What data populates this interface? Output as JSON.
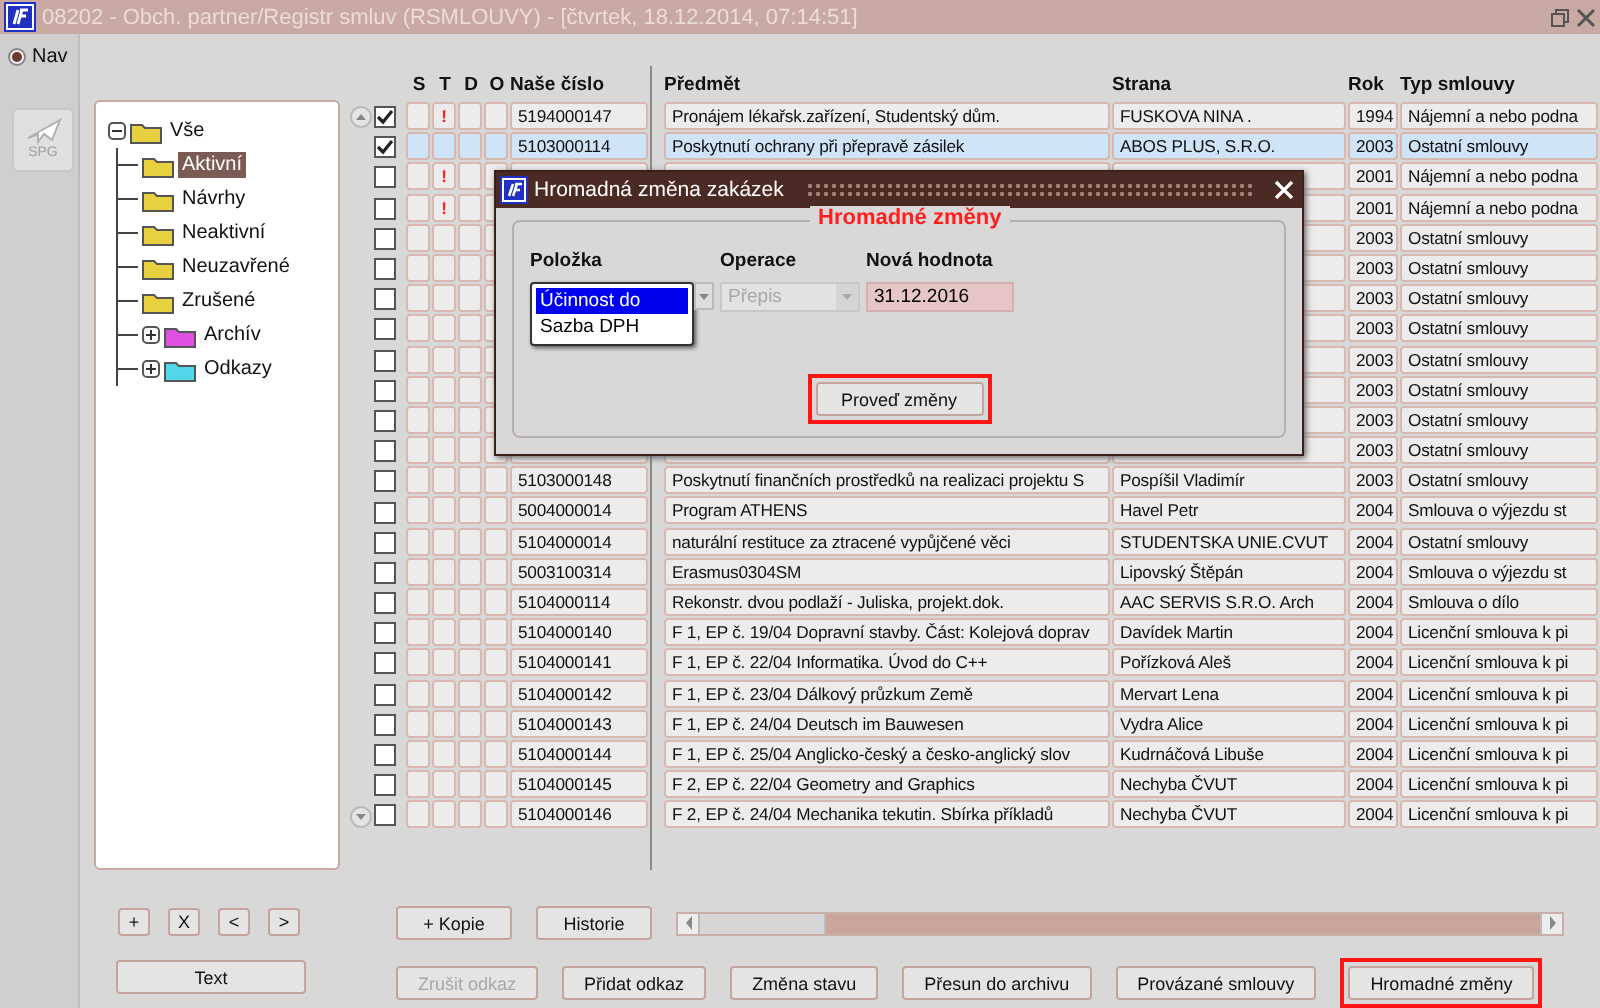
{
  "window": {
    "title": "08202 - Obch. partner/Registr smluv (RSMLOUVY) - [čtvrtek, 18.12.2014, 07:14:51]"
  },
  "nav": {
    "label": "Nav",
    "selected": true,
    "tool_label": "SPG"
  },
  "tree": [
    {
      "label": "Vše",
      "expanded": true,
      "selected": false,
      "color": "#e8d040",
      "children": [
        {
          "label": "Aktivní",
          "selected": true,
          "color": "#e8d040"
        },
        {
          "label": "Návrhy",
          "selected": false,
          "color": "#e8d040"
        },
        {
          "label": "Neaktivní",
          "selected": false,
          "color": "#e8d040"
        },
        {
          "label": "Neuzavřené",
          "selected": false,
          "color": "#e8d040"
        },
        {
          "label": "Zrušené",
          "selected": false,
          "color": "#e8d040"
        },
        {
          "label": "Archív",
          "expanded": false,
          "selected": false,
          "color": "#e050e0"
        },
        {
          "label": "Odkazy",
          "expanded": false,
          "selected": false,
          "color": "#50d8e8"
        }
      ]
    }
  ],
  "tree_buttons": [
    "+",
    "X",
    "<",
    ">"
  ],
  "text_button": "Text",
  "table": {
    "columns": [
      "S",
      "T",
      "D",
      "O",
      "Naše číslo",
      "Předmět",
      "Strana",
      "Rok",
      "Typ smlouvy"
    ],
    "rows": [
      {
        "checked": true,
        "selected": false,
        "t": "!",
        "number": "5194000147",
        "subject": "Pronájem lékařsk.zařízení, Studentský dům.",
        "party": "FUSKOVA NINA .",
        "year": "1994",
        "type": "Nájemní a nebo podna"
      },
      {
        "checked": true,
        "selected": true,
        "number": "5103000114",
        "subject": "Poskytnutí ochrany při přepravě zásilek",
        "party": "ABOS PLUS, S.R.O.",
        "year": "2003",
        "type": "Ostatní smlouvy"
      },
      {
        "checked": false,
        "selected": false,
        "t": "!",
        "year": "2001",
        "type": "Nájemní a nebo podna"
      },
      {
        "checked": false,
        "selected": false,
        "t": "!",
        "year": "2001",
        "type": "Nájemní a nebo podna"
      },
      {
        "checked": false,
        "selected": false,
        "year": "2003",
        "type": "Ostatní smlouvy"
      },
      {
        "checked": false,
        "selected": false,
        "year": "2003",
        "type": "Ostatní smlouvy"
      },
      {
        "checked": false,
        "selected": false,
        "year": "2003",
        "type": "Ostatní smlouvy"
      },
      {
        "checked": false,
        "selected": false,
        "year": "2003",
        "type": "Ostatní smlouvy"
      },
      {
        "checked": false,
        "selected": false,
        "year": "2003",
        "type": "Ostatní smlouvy"
      },
      {
        "checked": false,
        "selected": false,
        "year": "2003",
        "type": "Ostatní smlouvy"
      },
      {
        "checked": false,
        "selected": false,
        "year": "2003",
        "type": "Ostatní smlouvy"
      },
      {
        "checked": false,
        "selected": false,
        "year": "2003",
        "type": "Ostatní smlouvy"
      },
      {
        "checked": false,
        "selected": false,
        "number": "5103000148",
        "subject": "Poskytnutí finančních prostředků na realizaci projektu S",
        "party": "Pospíšil Vladimír",
        "year": "2003",
        "type": "Ostatní smlouvy"
      },
      {
        "checked": false,
        "selected": false,
        "number": "5004000014",
        "subject": "Program ATHENS",
        "party": "Havel Petr",
        "year": "2004",
        "type": "Smlouva o výjezdu st"
      },
      {
        "checked": false,
        "selected": false,
        "number": "5104000014",
        "subject": "naturální restituce za ztracené vypůjčené věci",
        "party": "STUDENTSKA UNIE.CVUT",
        "year": "2004",
        "type": "Ostatní smlouvy"
      },
      {
        "checked": false,
        "selected": false,
        "number": "5003100314",
        "subject": "Erasmus0304SM",
        "party": "Lipovský Štěpán",
        "year": "2004",
        "type": "Smlouva o výjezdu st"
      },
      {
        "checked": false,
        "selected": false,
        "number": "5104000114",
        "subject": "Rekonstr. dvou podlaží - Juliska, projekt.dok.",
        "party": "AAC SERVIS S.R.O. Arch",
        "year": "2004",
        "type": "Smlouva o dílo"
      },
      {
        "checked": false,
        "selected": false,
        "number": "5104000140",
        "subject": "F 1, EP č. 19/04 Dopravní stavby. Část: Kolejová doprav",
        "party": "Davídek Martin",
        "year": "2004",
        "type": "Licenční smlouva k pi"
      },
      {
        "checked": false,
        "selected": false,
        "number": "5104000141",
        "subject": "F 1, EP č. 22/04  Informatika. Úvod do C++",
        "party": "Pořízková Aleš",
        "year": "2004",
        "type": "Licenční smlouva k pi"
      },
      {
        "checked": false,
        "selected": false,
        "number": "5104000142",
        "subject": "F 1, EP č. 23/04  Dálkový průzkum Země",
        "party": "Mervart Lena",
        "year": "2004",
        "type": "Licenční smlouva k pi"
      },
      {
        "checked": false,
        "selected": false,
        "number": "5104000143",
        "subject": "F 1, EP č. 24/04  Deutsch im Bauwesen",
        "party": "Vydra Alice",
        "year": "2004",
        "type": "Licenční smlouva k pi"
      },
      {
        "checked": false,
        "selected": false,
        "number": "5104000144",
        "subject": "F 1,  EP č. 25/04  Anglicko-český a česko-anglický slov",
        "party": "Kudrnáčová Libuše",
        "year": "2004",
        "type": "Licenční smlouva k pi"
      },
      {
        "checked": false,
        "selected": false,
        "number": "5104000145",
        "subject": "F 2,  EP č. 22/04   Geometry and Graphics",
        "party": "Nechyba ČVUT",
        "year": "2004",
        "type": "Licenční smlouva k pi"
      },
      {
        "checked": false,
        "selected": false,
        "number": "5104000146",
        "subject": "F 2, EP č. 24/04   Mechanika tekutin. Sbírka příkladů",
        "party": "Nechyba ČVUT",
        "year": "2004",
        "type": "Licenční smlouva k pi"
      }
    ]
  },
  "buttons_row1": [
    {
      "label": "+ Kopie",
      "disabled": false,
      "highlighted": false
    },
    {
      "label": "Historie",
      "disabled": false,
      "highlighted": false
    }
  ],
  "buttons_row2": [
    {
      "label": "Zrušit odkaz",
      "disabled": true,
      "highlighted": false
    },
    {
      "label": "Přidat odkaz",
      "disabled": false,
      "highlighted": false
    },
    {
      "label": "Změna stavu",
      "disabled": false,
      "highlighted": false
    },
    {
      "label": "Přesun do archivu",
      "disabled": false,
      "highlighted": false
    },
    {
      "label": "Provázané smlouvy",
      "disabled": false,
      "highlighted": false
    },
    {
      "label": "Hromadné změny",
      "disabled": false,
      "highlighted": true
    }
  ],
  "dialog": {
    "title": "Hromadná změna zakázek",
    "legend": "Hromadné změny",
    "labels": [
      "Položka",
      "Operace",
      "Nová hodnota"
    ],
    "items": [
      {
        "label": "Účinnost do",
        "selected": true
      },
      {
        "label": "Sazba DPH",
        "selected": false
      }
    ],
    "operation": {
      "value": "Přepis",
      "disabled": true
    },
    "new_value": "31.12.2016",
    "button": {
      "label": "Proveď změny",
      "disabled": false,
      "highlighted": true
    }
  }
}
